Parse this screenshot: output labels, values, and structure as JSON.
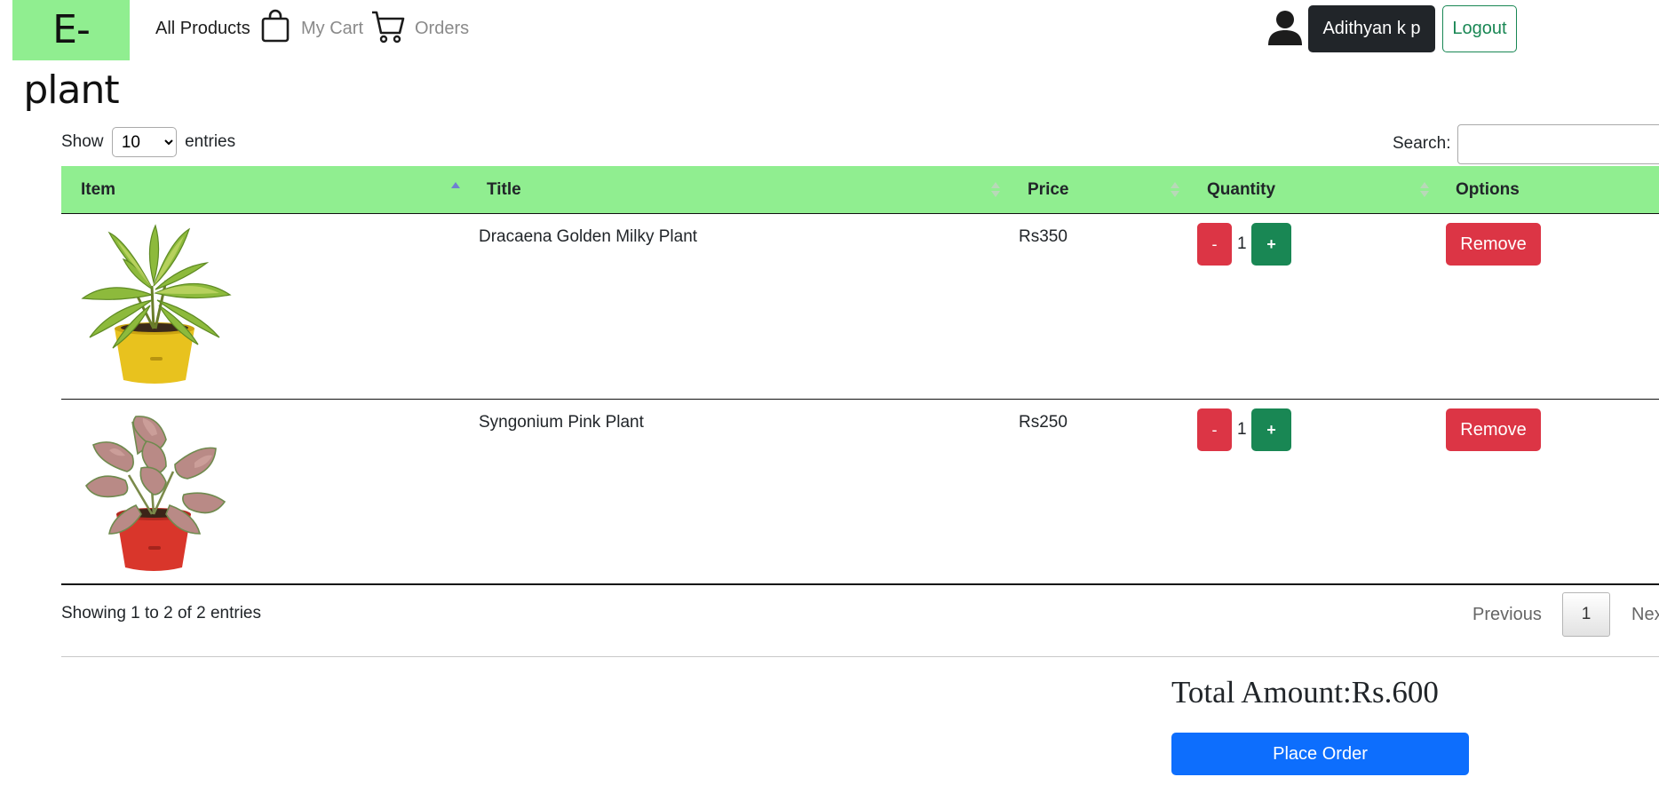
{
  "navbar": {
    "logo": "E-plant",
    "links": [
      {
        "label": "All Products",
        "icon": "bag-icon"
      },
      {
        "label": "My Cart",
        "icon": "cart-icon"
      },
      {
        "label": "Orders"
      }
    ],
    "user": {
      "icon": "user-icon",
      "name": "Adithyan k p"
    },
    "logout_label": "Logout"
  },
  "controls": {
    "show_label": "Show",
    "entries_label": "entries",
    "length_value": "10",
    "search_label": "Search:"
  },
  "table": {
    "headers": [
      "Item",
      "Title",
      "Price",
      "Quantity",
      "Options"
    ],
    "sort": {
      "column": "Item",
      "direction": "ascending"
    },
    "rows": [
      {
        "image": "dracaena-plant-image",
        "title": "Dracaena Golden Milky Plant",
        "price": "Rs350",
        "quantity": "1",
        "minus": "-",
        "plus": "+",
        "option": "Remove"
      },
      {
        "image": "syngonium-plant-image",
        "title": "Syngonium Pink Plant",
        "price": "Rs250",
        "quantity": "1",
        "minus": "-",
        "plus": "+",
        "option": "Remove"
      }
    ]
  },
  "footer": {
    "info": "Showing 1 to 2 of 2 entries",
    "previous": "Previous",
    "page": "1",
    "next": "Nex"
  },
  "summary": {
    "total_label": "Total Amount:",
    "total_value": "Rs.600",
    "place_order": "Place Order"
  },
  "colors": {
    "brand_green": "#90ee90",
    "danger": "#dc3545",
    "success": "#198754",
    "primary": "#0d6efd",
    "dark": "#212529"
  }
}
